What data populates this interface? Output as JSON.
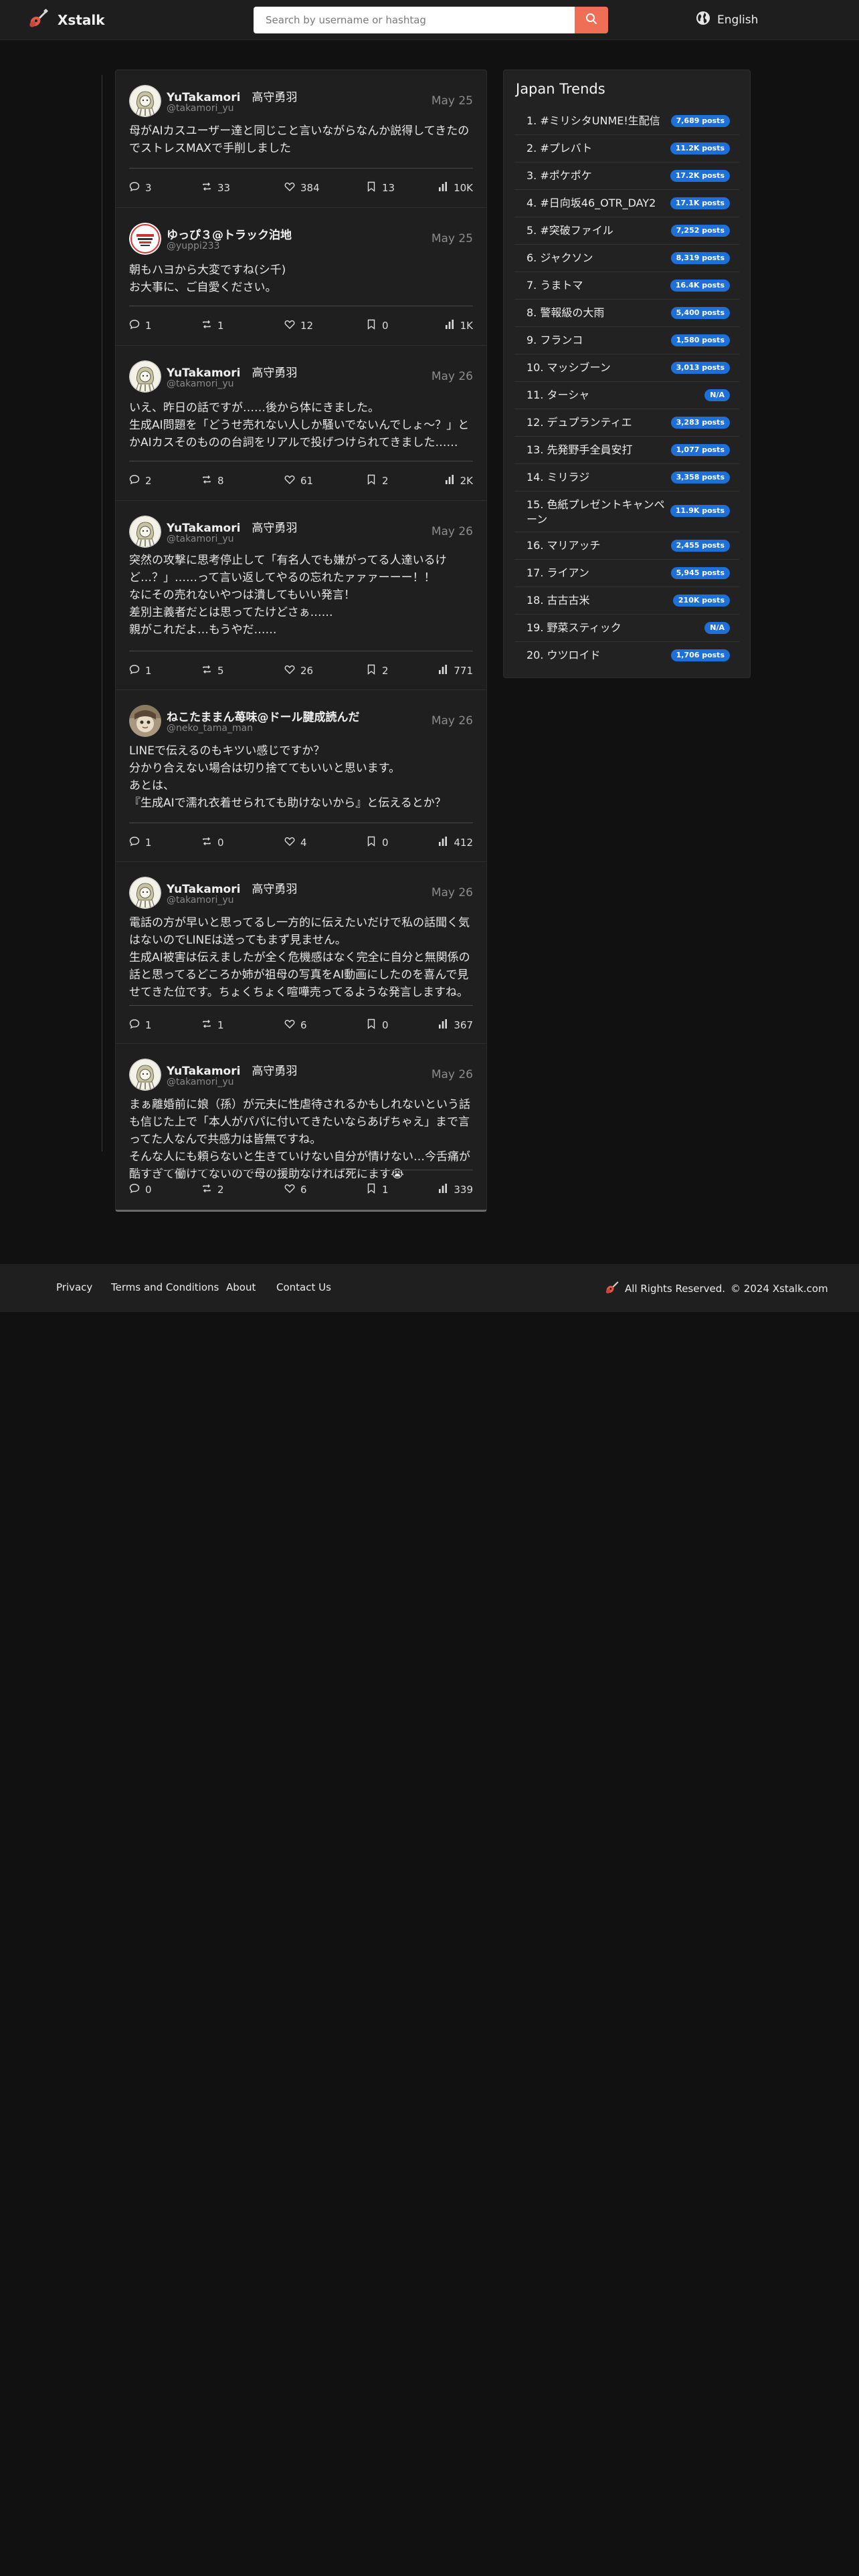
{
  "header": {
    "brand": "Xstalk",
    "search_placeholder": "Search by username or hashtag",
    "language": "English"
  },
  "posts": [
    {
      "name": "YuTakamori",
      "name_jp": "　高守勇羽",
      "handle": "@takamori_yu",
      "date": "May 25",
      "text": "母がAIカスユーザー達と同じこと言いながらなんか説得してきたのでストレスMAXで手削しました",
      "reply": "3",
      "repost": "33",
      "like": "384",
      "bookmark": "13",
      "views": "10K"
    },
    {
      "name": "ゆっぴ３@トラック泊地",
      "name_jp": "",
      "handle": "@yuppi233",
      "date": "May 25",
      "text": "朝もハヨから大変ですね(シ千)\nお大事に、ご自愛ください。",
      "reply": "1",
      "repost": "1",
      "like": "12",
      "bookmark": "0",
      "views": "1K"
    },
    {
      "name": "YuTakamori",
      "name_jp": "　高守勇羽",
      "handle": "@takamori_yu",
      "date": "May 26",
      "text": "いえ、昨日の話ですが……後から体にきました。\n生成AI問題を「どうせ売れない人しか騒いでないんでしょ〜？」とかAIカスそのものの台詞をリアルで投げつけられてきました……",
      "reply": "2",
      "repost": "8",
      "like": "61",
      "bookmark": "2",
      "views": "2K"
    },
    {
      "name": "YuTakamori",
      "name_jp": "　高守勇羽",
      "handle": "@takamori_yu",
      "date": "May 26",
      "text": "突然の攻撃に思考停止して「有名人でも嫌がってる人達いるけど…？」……って言い返してやるの忘れたァァァーーー！！\nなにその売れないやつは潰してもいい発言！\n差別主義者だとは思ってたけどさぁ……\n親がこれだよ…もうやだ……",
      "reply": "1",
      "repost": "5",
      "like": "26",
      "bookmark": "2",
      "views": "771"
    },
    {
      "name": "ねこたままん苺味@ドール腱成読んだ",
      "name_jp": "",
      "handle": "@neko_tama_man",
      "date": "May 26",
      "text": "LINEで伝えるのもキツい感じですか？\n分かり合えない場合は切り捨ててもいいと思います。\nあとは、\n『生成AIで濡れ衣着せられても助けないから』と伝えるとか？",
      "reply": "1",
      "repost": "0",
      "like": "4",
      "bookmark": "0",
      "views": "412"
    },
    {
      "name": "YuTakamori",
      "name_jp": "　高守勇羽",
      "handle": "@takamori_yu",
      "date": "May 26",
      "text": "電話の方が早いと思ってるし一方的に伝えたいだけで私の話聞く気はないのでLINEは送ってもまず見ません。\n生成AI被害は伝えましたが全く危機感はなく完全に自分と無関係の話と思ってるどころか姉が祖母の写真をAI動画にしたのを喜んで見せてきた位です。ちょくちょく喧嘩売ってるような発言しますね。",
      "reply": "1",
      "repost": "1",
      "like": "6",
      "bookmark": "0",
      "views": "367"
    },
    {
      "name": "YuTakamori",
      "name_jp": "　高守勇羽",
      "handle": "@takamori_yu",
      "date": "May 26",
      "text": "まぁ離婚前に娘（孫）が元夫に性虐待されるかもしれないという話も信じた上で「本人がパパに付いてきたいならあげちゃえ」まで言ってた人なんで共感力は皆無ですね。\nそんな人にも頼らないと生きていけない自分が情けない…今舌痛が酷すぎて働けてないので母の援助なければ死にます😭",
      "reply": "0",
      "repost": "2",
      "like": "6",
      "bookmark": "1",
      "views": "339"
    }
  ],
  "trends": {
    "title": "Japan Trends",
    "items": [
      {
        "label": "1. #ミリシタUNME!生配信",
        "count": "7,689 posts"
      },
      {
        "label": "2. #プレバト",
        "count": "11.2K posts"
      },
      {
        "label": "3. #ポケポケ",
        "count": "17.2K posts"
      },
      {
        "label": "4. #日向坂46_OTR_DAY2",
        "count": "17.1K posts"
      },
      {
        "label": "5. #突破ファイル",
        "count": "7,252 posts"
      },
      {
        "label": "6. ジャクソン",
        "count": "8,319 posts"
      },
      {
        "label": "7. うまトマ",
        "count": "16.4K posts"
      },
      {
        "label": "8. 警報級の大雨",
        "count": "5,400 posts"
      },
      {
        "label": "9. フランコ",
        "count": "1,580 posts"
      },
      {
        "label": "10. マッシブーン",
        "count": "3,013 posts"
      },
      {
        "label": "11. ターシャ",
        "count": "N/A"
      },
      {
        "label": "12. デュプランティエ",
        "count": "3,283 posts"
      },
      {
        "label": "13. 先発野手全員安打",
        "count": "1,077 posts"
      },
      {
        "label": "14. ミリラジ",
        "count": "3,358 posts"
      },
      {
        "label": "15. 色紙プレゼントキャンペーン",
        "count": "11.9K posts"
      },
      {
        "label": "16. マリアッチ",
        "count": "2,455 posts"
      },
      {
        "label": "17. ライアン",
        "count": "5,945 posts"
      },
      {
        "label": "18. 古古古米",
        "count": "210K posts"
      },
      {
        "label": "19. 野菜スティック",
        "count": "N/A"
      },
      {
        "label": "20. ウツロイド",
        "count": "1,706 posts"
      }
    ]
  },
  "footer": {
    "links": [
      "Privacy",
      "Terms and Conditions",
      "About",
      "Contact Us"
    ],
    "rights": "All Rights Reserved.",
    "copyright": "© 2024 Xstalk.com"
  },
  "colors": {
    "page_bg": "#111111",
    "panel_bg": "#1f1f1f",
    "accent": "#ee6f55",
    "badge": "#1e6fd8"
  },
  "icons": {
    "brand": "guitar-logo-icon",
    "search": "search-icon",
    "language": "globe-icon",
    "reply": "comment-icon",
    "repost": "repost-icon",
    "like": "heart-icon",
    "bookmark": "bookmark-icon",
    "views": "bar-chart-icon"
  }
}
